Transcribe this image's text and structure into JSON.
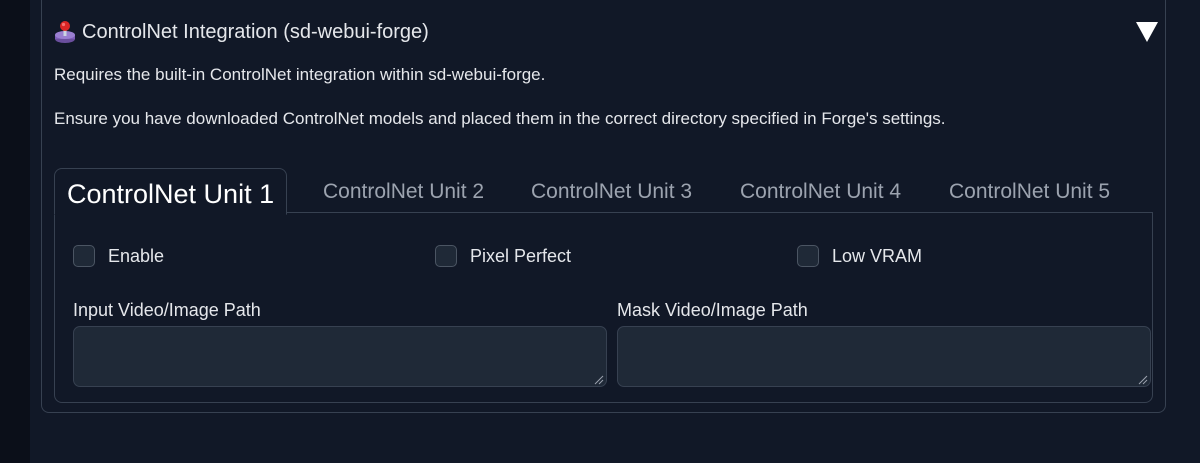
{
  "accordion": {
    "title": "ControlNet Integration (sd-webui-forge)",
    "icon": "joystick-icon",
    "expanded": true,
    "description_1": "Requires the built-in ControlNet integration within sd-webui-forge.",
    "description_2": "Ensure you have downloaded ControlNet models and placed them in the correct directory specified in Forge's settings."
  },
  "tabs": [
    {
      "label": "ControlNet Unit 1",
      "active": true
    },
    {
      "label": "ControlNet Unit 2",
      "active": false
    },
    {
      "label": "ControlNet Unit 3",
      "active": false
    },
    {
      "label": "ControlNet Unit 4",
      "active": false
    },
    {
      "label": "ControlNet Unit 5",
      "active": false
    }
  ],
  "unit": {
    "enable_label": "Enable",
    "enable_checked": false,
    "pixel_perfect_label": "Pixel Perfect",
    "pixel_perfect_checked": false,
    "low_vram_label": "Low VRAM",
    "low_vram_checked": false,
    "input_path_label": "Input Video/Image Path",
    "input_path_value": "",
    "mask_path_label": "Mask Video/Image Path",
    "mask_path_value": ""
  },
  "colors": {
    "background": "#0b0f19",
    "panel": "#111827",
    "border": "#374151",
    "input_bg": "#1f2937",
    "text": "#e5e7eb",
    "tab_inactive": "#9ca3af"
  }
}
